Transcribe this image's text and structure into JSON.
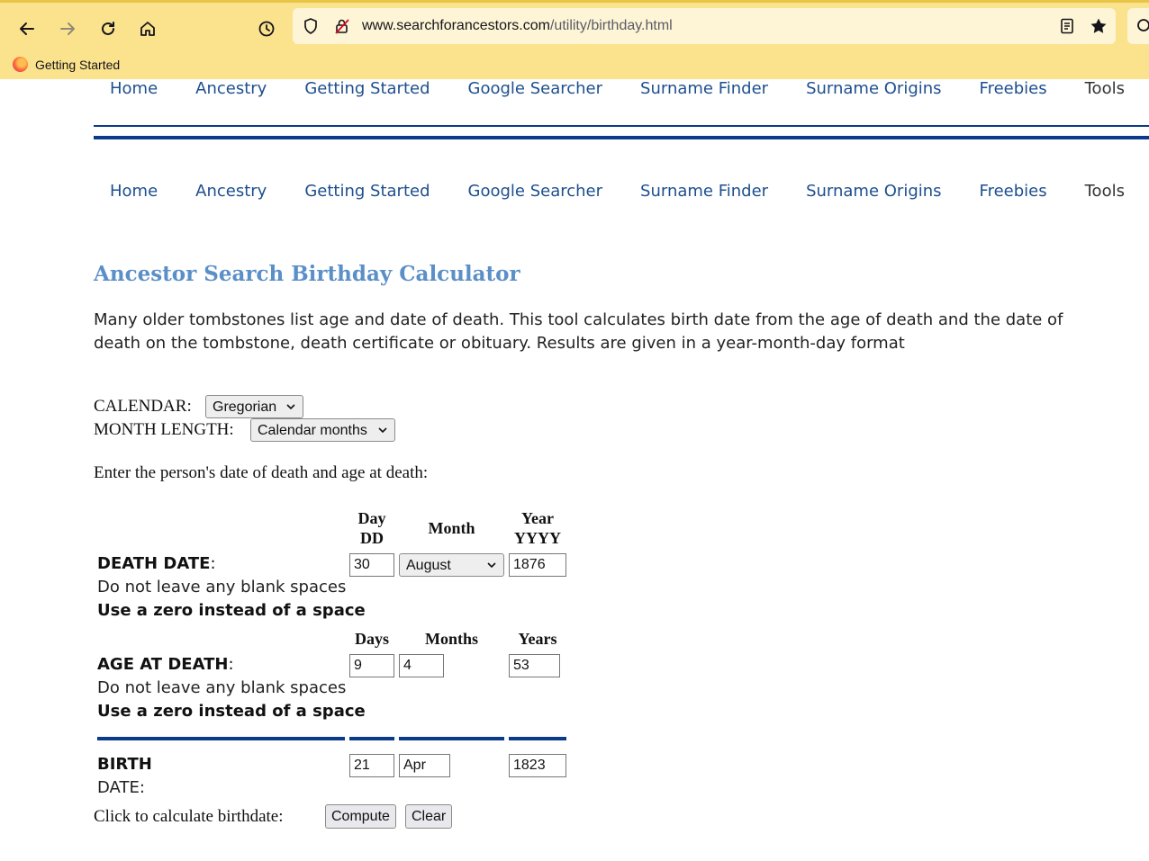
{
  "browser": {
    "url_domain": "www.searchforancestors.com",
    "url_path": "/utility/birthday.html",
    "bookmark_label": "Getting Started"
  },
  "nav": {
    "items": [
      {
        "label": "Home"
      },
      {
        "label": "Ancestry"
      },
      {
        "label": "Getting Started"
      },
      {
        "label": "Google Searcher"
      },
      {
        "label": "Surname Finder"
      },
      {
        "label": "Surname Origins"
      },
      {
        "label": "Freebies"
      },
      {
        "label": "Tools"
      }
    ]
  },
  "page": {
    "title": "Ancestor Search Birthday Calculator",
    "intro": "Many older tombstones list age and date of death. This tool calculates birth date from the age of death and the date of death on the tombstone, death certificate or obituary. Results are given in a year-month-day format"
  },
  "form": {
    "calendar_label": "CALENDAR:",
    "calendar_value": "Gregorian",
    "month_length_label": "MONTH LENGTH:",
    "month_length_value": "Calendar months",
    "instruction": "Enter the person's date of death and age at death:",
    "death_headers": {
      "day": "Day",
      "day_fmt": "DD",
      "month": "Month",
      "year": "Year",
      "year_fmt": "YYYY"
    },
    "death_label": "DEATH DATE",
    "colon": ":",
    "death_day": "30",
    "death_month": "August",
    "death_year": "1876",
    "note_blank": "Do not leave any blank spaces",
    "note_zero": "Use a zero instead of a space",
    "age_headers": {
      "days": "Days",
      "months": "Months",
      "years": "Years"
    },
    "age_label": "AGE AT DEATH",
    "age_days": "9",
    "age_months": "4",
    "age_years": "53",
    "birth_label_1": "BIRTH",
    "birth_label_2": "DATE:",
    "birth_day": "21",
    "birth_month": "Apr",
    "birth_year": "1823",
    "compute_prompt": "Click to calculate birthdate:",
    "compute_button": "Compute",
    "clear_button": "Clear"
  }
}
